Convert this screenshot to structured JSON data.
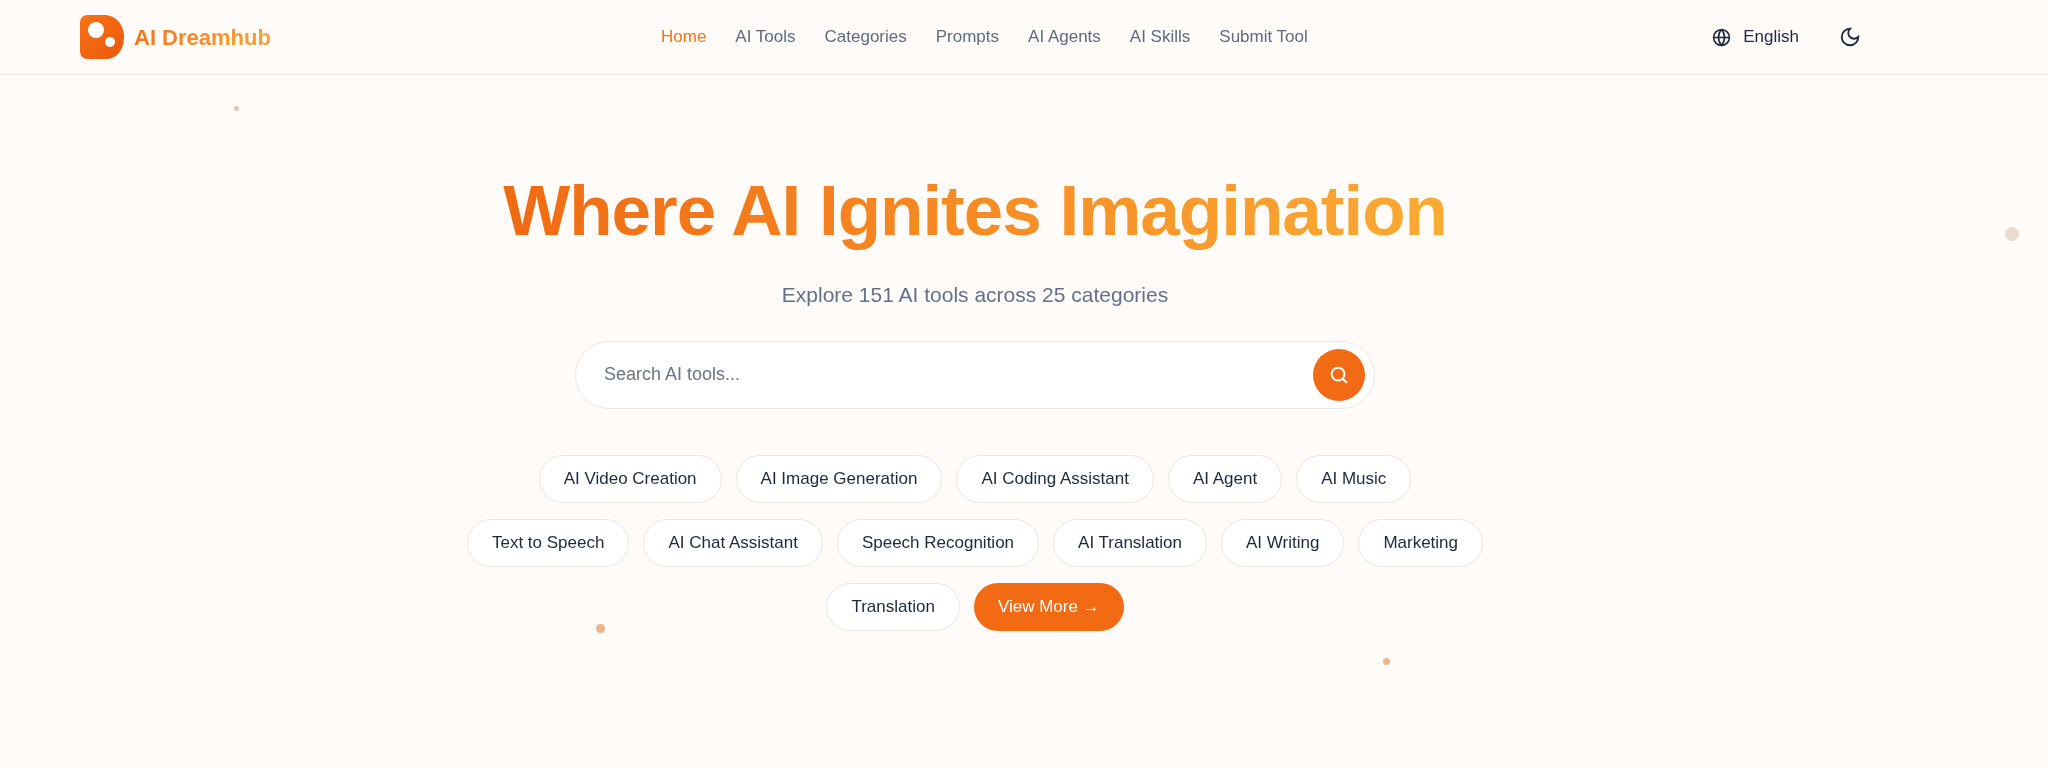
{
  "brand": {
    "name": "AI Dreamhub"
  },
  "nav": [
    {
      "label": "Home",
      "selected": true
    },
    {
      "label": "AI Tools",
      "selected": false
    },
    {
      "label": "Categories",
      "selected": false
    },
    {
      "label": "Prompts",
      "selected": false
    },
    {
      "label": "AI Agents",
      "selected": false
    },
    {
      "label": "AI Skills",
      "selected": false
    },
    {
      "label": "Submit Tool",
      "selected": false
    }
  ],
  "language": "English",
  "hero": {
    "title": "Where AI Ignites Imagination",
    "subtitle": "Explore 151 AI tools across 25 categories"
  },
  "search": {
    "placeholder": "Search AI tools..."
  },
  "tag_rows": [
    [
      {
        "kind": "tag",
        "label": "AI Video Creation"
      },
      {
        "kind": "tag",
        "label": "AI Image Generation"
      },
      {
        "kind": "tag",
        "label": "AI Coding Assistant"
      },
      {
        "kind": "tag",
        "label": "AI Agent"
      },
      {
        "kind": "tag",
        "label": "AI Music"
      }
    ],
    [
      {
        "kind": "tag",
        "label": "Text to Speech"
      },
      {
        "kind": "tag",
        "label": "AI Chat Assistant"
      },
      {
        "kind": "tag",
        "label": "Speech Recognition"
      },
      {
        "kind": "tag",
        "label": "AI Translation"
      },
      {
        "kind": "tag",
        "label": "AI Writing"
      },
      {
        "kind": "tag",
        "label": "Marketing"
      }
    ],
    [
      {
        "kind": "tag",
        "label": "Translation"
      },
      {
        "kind": "more",
        "label": "View More →"
      }
    ]
  ]
}
